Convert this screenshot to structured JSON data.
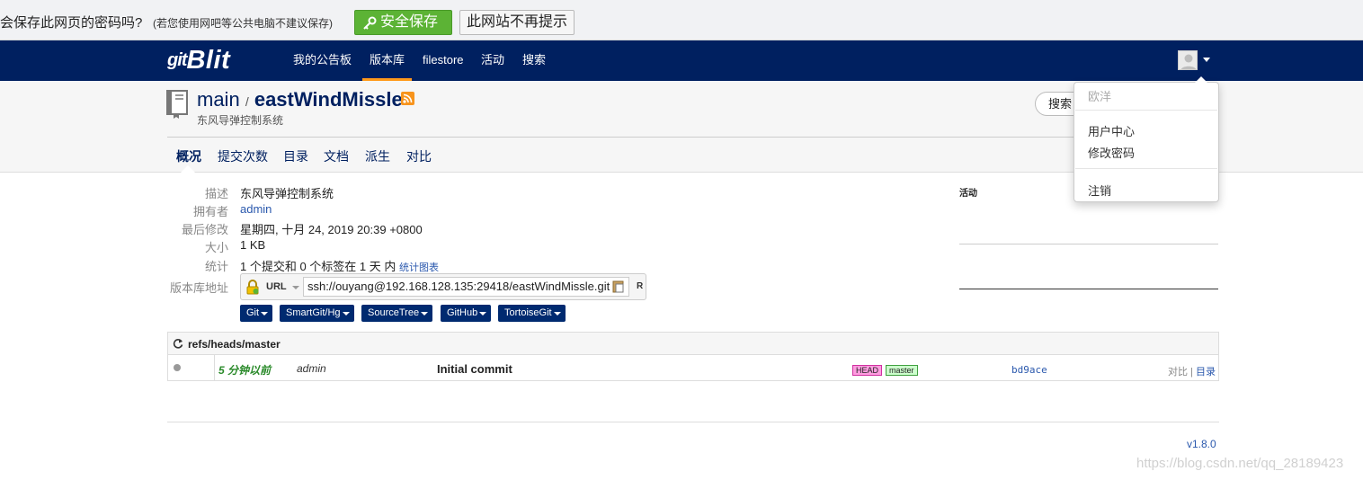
{
  "password_bar": {
    "question": "会保存此网页的密码吗?",
    "note": "(若您使用网吧等公共电脑不建议保存)",
    "save_button": "安全保存",
    "never_button": "此网站不再提示"
  },
  "navbar": {
    "logo_prefix": "git",
    "logo_main": "Blit",
    "items": [
      "我的公告板",
      "版本库",
      "filestore",
      "活动",
      "搜索"
    ],
    "active_item": "版本库"
  },
  "repo": {
    "project": "main",
    "separator": "/",
    "name": "eastWindMissle",
    "description": "东风导弹控制系统",
    "search_label": "搜索"
  },
  "tabs": [
    "概况",
    "提交次数",
    "目录",
    "文档",
    "派生",
    "对比"
  ],
  "info": {
    "labels": [
      "描述",
      "拥有者",
      "最后修改",
      "大小",
      "统计",
      "版本库地址"
    ],
    "description": "东风导弹控制系统",
    "owner": "admin",
    "last_modified": "星期四, 十月 24, 2019 20:39 +0800",
    "size": "1 KB",
    "stats": "1 个提交和 0 个标签在 1 天 内",
    "stats_link": "统计图表",
    "url_protocol": "URL",
    "url": "ssh://ouyang@192.168.128.135:29418/eastWindMissle.git",
    "url_suffix": "R"
  },
  "clients": [
    "Git",
    "SmartGit/Hg",
    "SourceTree",
    "GitHub",
    "TortoiseGit"
  ],
  "activity": {
    "title": "活动"
  },
  "commits": {
    "ref": "refs/heads/master",
    "rows": [
      {
        "ago": "5 分钟以前",
        "author": "admin",
        "message": "Initial commit",
        "tags": [
          "HEAD",
          "master"
        ],
        "sha": "bd9ace",
        "link_compare": "对比",
        "link_sep": "|",
        "link_tree": "目录"
      }
    ]
  },
  "footer": {
    "version": "v1.8.0",
    "watermark": "https://blog.csdn.net/qq_28189423"
  },
  "user_menu": {
    "username": "欧洋",
    "items": [
      "用户中心",
      "修改密码",
      "注销"
    ]
  },
  "colors": {
    "navbar": "#002060",
    "accent": "#ff9a1a",
    "save_green": "#5cb335",
    "client_button": "#002a70"
  }
}
